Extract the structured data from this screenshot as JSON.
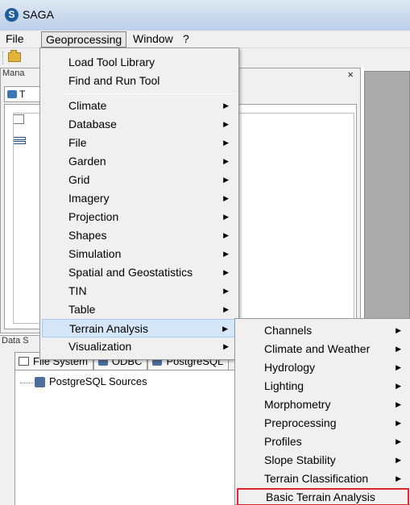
{
  "window": {
    "title": "SAGA"
  },
  "menubar": [
    {
      "label": "File"
    },
    {
      "label": "Geoprocessing"
    },
    {
      "label": "Window"
    },
    {
      "label": "?"
    }
  ],
  "manager": {
    "label": "Mana",
    "tab_label": "T"
  },
  "data_panel": {
    "label": "Data S",
    "tabs": [
      {
        "label": "File System"
      },
      {
        "label": "ODBC"
      },
      {
        "label": "PostgreSQL"
      }
    ],
    "tree_item": "PostgreSQL Sources"
  },
  "geoprocessing_menu": {
    "top_items": [
      {
        "label": "Load Tool Library"
      },
      {
        "label": "Find and Run Tool"
      }
    ],
    "categories": [
      {
        "label": "Climate"
      },
      {
        "label": "Database"
      },
      {
        "label": "File"
      },
      {
        "label": "Garden"
      },
      {
        "label": "Grid"
      },
      {
        "label": "Imagery"
      },
      {
        "label": "Projection"
      },
      {
        "label": "Shapes"
      },
      {
        "label": "Simulation"
      },
      {
        "label": "Spatial and Geostatistics"
      },
      {
        "label": "TIN"
      },
      {
        "label": "Table"
      },
      {
        "label": "Terrain Analysis"
      },
      {
        "label": "Visualization"
      }
    ]
  },
  "terrain_submenu": [
    {
      "label": "Channels"
    },
    {
      "label": "Climate and Weather"
    },
    {
      "label": "Hydrology"
    },
    {
      "label": "Lighting"
    },
    {
      "label": "Morphometry"
    },
    {
      "label": "Preprocessing"
    },
    {
      "label": "Profiles"
    },
    {
      "label": "Slope Stability"
    },
    {
      "label": "Terrain Classification"
    },
    {
      "label": "Basic Terrain Analysis"
    }
  ],
  "icons": {
    "app": "saga-logo-icon",
    "open": "folder-open-icon",
    "submenu": "chevron-right-icon",
    "close": "close-icon"
  },
  "colors": {
    "highlight": "#d5e6f8",
    "selection_box": "#e0262d",
    "titlebar": "#c9d9ed"
  }
}
